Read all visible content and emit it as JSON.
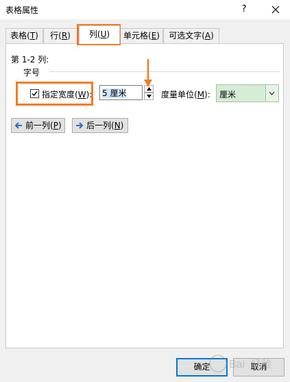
{
  "window": {
    "title": "表格属性",
    "help_glyph": "?",
    "close_glyph": "✕"
  },
  "tabs": [
    {
      "label": "表格(",
      "key": "T",
      "tail": ")",
      "active": false
    },
    {
      "label": "行(",
      "key": "R",
      "tail": ")",
      "active": false
    },
    {
      "label": "列(",
      "key": "U",
      "tail": ")",
      "active": true
    },
    {
      "label": "单元格(",
      "key": "E",
      "tail": ")",
      "active": false
    },
    {
      "label": "可选文字(",
      "key": "A",
      "tail": ")",
      "active": false
    }
  ],
  "column_tab": {
    "range_label": "第 1-2 列:",
    "section_label": "字号",
    "specify_width": {
      "label_prefix": "指定宽度(",
      "key": "W",
      "label_suffix": "):",
      "checked": true
    },
    "width_value": "5 厘米",
    "unit_label_prefix": "度量单位(",
    "unit_key": "M",
    "unit_label_suffix": "):",
    "unit_value": "厘米",
    "prev_column": {
      "prefix": "前一列(",
      "key": "P",
      "suffix": ")"
    },
    "next_column": {
      "prefix": "后一列(",
      "key": "N",
      "suffix": ")"
    }
  },
  "footer": {
    "ok_label": "确定",
    "cancel_label": "取消"
  },
  "colors": {
    "highlight_orange": "#f47b20",
    "unit_select_bg": "#d6ecd6",
    "default_button_border": "#0078d7",
    "arrow_icon_blue": "#2b6cc4"
  },
  "watermark": {
    "text": "Bai 经验"
  }
}
